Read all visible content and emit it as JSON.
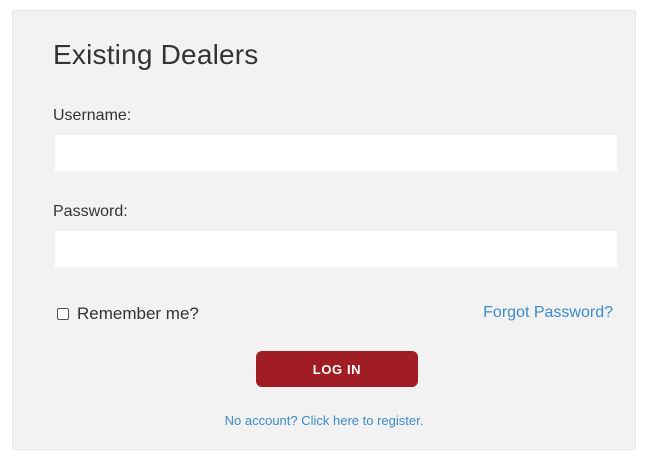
{
  "login": {
    "title": "Existing Dealers",
    "username_label": "Username:",
    "username_value": "",
    "password_label": "Password:",
    "password_value": "",
    "remember_label": "Remember me?",
    "remember_checked": false,
    "forgot_link": "Forgot Password?",
    "login_button": "LOG IN",
    "register_link": "No account? Click here to register."
  },
  "colors": {
    "panel_background": "#f2f2f2",
    "button_background": "#a11d24",
    "link_color": "#3d8bc9",
    "text_color": "#333333"
  }
}
